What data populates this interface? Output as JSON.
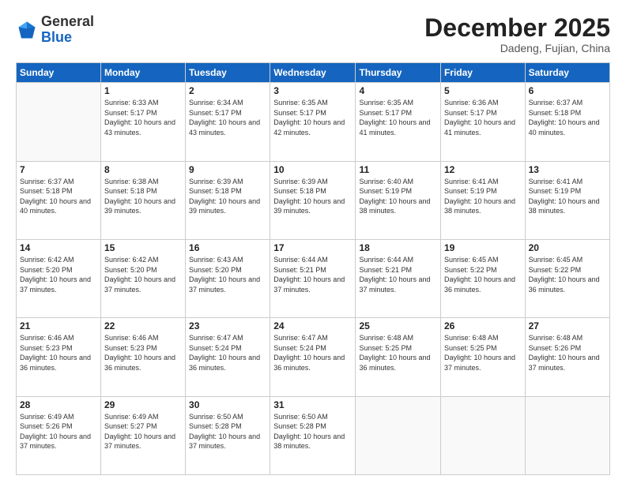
{
  "header": {
    "logo_general": "General",
    "logo_blue": "Blue",
    "month_title": "December 2025",
    "location": "Dadeng, Fujian, China"
  },
  "days_of_week": [
    "Sunday",
    "Monday",
    "Tuesday",
    "Wednesday",
    "Thursday",
    "Friday",
    "Saturday"
  ],
  "weeks": [
    [
      {
        "day": "",
        "info": ""
      },
      {
        "day": "1",
        "info": "Sunrise: 6:33 AM\nSunset: 5:17 PM\nDaylight: 10 hours and 43 minutes."
      },
      {
        "day": "2",
        "info": "Sunrise: 6:34 AM\nSunset: 5:17 PM\nDaylight: 10 hours and 43 minutes."
      },
      {
        "day": "3",
        "info": "Sunrise: 6:35 AM\nSunset: 5:17 PM\nDaylight: 10 hours and 42 minutes."
      },
      {
        "day": "4",
        "info": "Sunrise: 6:35 AM\nSunset: 5:17 PM\nDaylight: 10 hours and 41 minutes."
      },
      {
        "day": "5",
        "info": "Sunrise: 6:36 AM\nSunset: 5:17 PM\nDaylight: 10 hours and 41 minutes."
      },
      {
        "day": "6",
        "info": "Sunrise: 6:37 AM\nSunset: 5:18 PM\nDaylight: 10 hours and 40 minutes."
      }
    ],
    [
      {
        "day": "7",
        "info": "Sunrise: 6:37 AM\nSunset: 5:18 PM\nDaylight: 10 hours and 40 minutes."
      },
      {
        "day": "8",
        "info": "Sunrise: 6:38 AM\nSunset: 5:18 PM\nDaylight: 10 hours and 39 minutes."
      },
      {
        "day": "9",
        "info": "Sunrise: 6:39 AM\nSunset: 5:18 PM\nDaylight: 10 hours and 39 minutes."
      },
      {
        "day": "10",
        "info": "Sunrise: 6:39 AM\nSunset: 5:18 PM\nDaylight: 10 hours and 39 minutes."
      },
      {
        "day": "11",
        "info": "Sunrise: 6:40 AM\nSunset: 5:19 PM\nDaylight: 10 hours and 38 minutes."
      },
      {
        "day": "12",
        "info": "Sunrise: 6:41 AM\nSunset: 5:19 PM\nDaylight: 10 hours and 38 minutes."
      },
      {
        "day": "13",
        "info": "Sunrise: 6:41 AM\nSunset: 5:19 PM\nDaylight: 10 hours and 38 minutes."
      }
    ],
    [
      {
        "day": "14",
        "info": "Sunrise: 6:42 AM\nSunset: 5:20 PM\nDaylight: 10 hours and 37 minutes."
      },
      {
        "day": "15",
        "info": "Sunrise: 6:42 AM\nSunset: 5:20 PM\nDaylight: 10 hours and 37 minutes."
      },
      {
        "day": "16",
        "info": "Sunrise: 6:43 AM\nSunset: 5:20 PM\nDaylight: 10 hours and 37 minutes."
      },
      {
        "day": "17",
        "info": "Sunrise: 6:44 AM\nSunset: 5:21 PM\nDaylight: 10 hours and 37 minutes."
      },
      {
        "day": "18",
        "info": "Sunrise: 6:44 AM\nSunset: 5:21 PM\nDaylight: 10 hours and 37 minutes."
      },
      {
        "day": "19",
        "info": "Sunrise: 6:45 AM\nSunset: 5:22 PM\nDaylight: 10 hours and 36 minutes."
      },
      {
        "day": "20",
        "info": "Sunrise: 6:45 AM\nSunset: 5:22 PM\nDaylight: 10 hours and 36 minutes."
      }
    ],
    [
      {
        "day": "21",
        "info": "Sunrise: 6:46 AM\nSunset: 5:23 PM\nDaylight: 10 hours and 36 minutes."
      },
      {
        "day": "22",
        "info": "Sunrise: 6:46 AM\nSunset: 5:23 PM\nDaylight: 10 hours and 36 minutes."
      },
      {
        "day": "23",
        "info": "Sunrise: 6:47 AM\nSunset: 5:24 PM\nDaylight: 10 hours and 36 minutes."
      },
      {
        "day": "24",
        "info": "Sunrise: 6:47 AM\nSunset: 5:24 PM\nDaylight: 10 hours and 36 minutes."
      },
      {
        "day": "25",
        "info": "Sunrise: 6:48 AM\nSunset: 5:25 PM\nDaylight: 10 hours and 36 minutes."
      },
      {
        "day": "26",
        "info": "Sunrise: 6:48 AM\nSunset: 5:25 PM\nDaylight: 10 hours and 37 minutes."
      },
      {
        "day": "27",
        "info": "Sunrise: 6:48 AM\nSunset: 5:26 PM\nDaylight: 10 hours and 37 minutes."
      }
    ],
    [
      {
        "day": "28",
        "info": "Sunrise: 6:49 AM\nSunset: 5:26 PM\nDaylight: 10 hours and 37 minutes."
      },
      {
        "day": "29",
        "info": "Sunrise: 6:49 AM\nSunset: 5:27 PM\nDaylight: 10 hours and 37 minutes."
      },
      {
        "day": "30",
        "info": "Sunrise: 6:50 AM\nSunset: 5:28 PM\nDaylight: 10 hours and 37 minutes."
      },
      {
        "day": "31",
        "info": "Sunrise: 6:50 AM\nSunset: 5:28 PM\nDaylight: 10 hours and 38 minutes."
      },
      {
        "day": "",
        "info": ""
      },
      {
        "day": "",
        "info": ""
      },
      {
        "day": "",
        "info": ""
      }
    ]
  ]
}
